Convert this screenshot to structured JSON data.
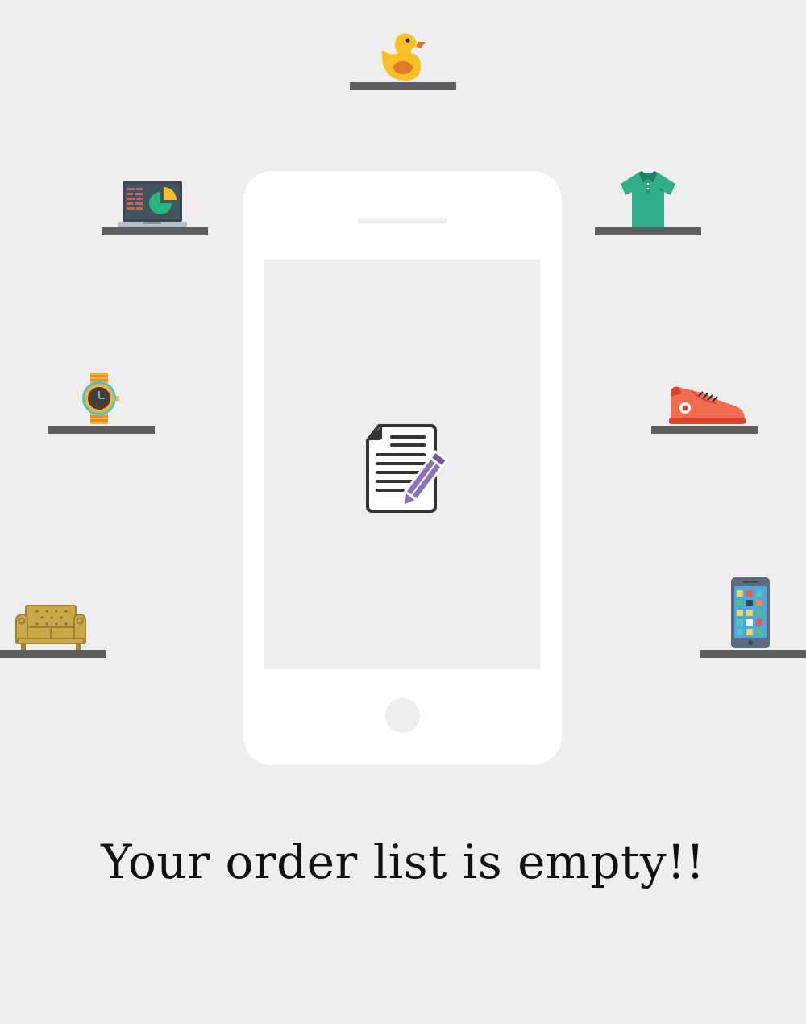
{
  "empty_state": {
    "message": "Your order list is empty!!"
  },
  "products": [
    {
      "name": "rubber-duck",
      "icon": "duck-icon"
    },
    {
      "name": "laptop",
      "icon": "laptop-icon"
    },
    {
      "name": "polo-shirt",
      "icon": "shirt-icon"
    },
    {
      "name": "wrist-watch",
      "icon": "watch-icon"
    },
    {
      "name": "sneaker",
      "icon": "sneaker-icon"
    },
    {
      "name": "sofa",
      "icon": "sofa-icon"
    },
    {
      "name": "smartphone",
      "icon": "smartphone-icon"
    }
  ],
  "illustration": {
    "phone_icon": "phone-frame",
    "center_icon": "document-edit-icon"
  },
  "colors": {
    "background": "#eeeeee",
    "shelf": "#5f5f5f",
    "text": "#111111",
    "pencil": "#8a74b8"
  }
}
